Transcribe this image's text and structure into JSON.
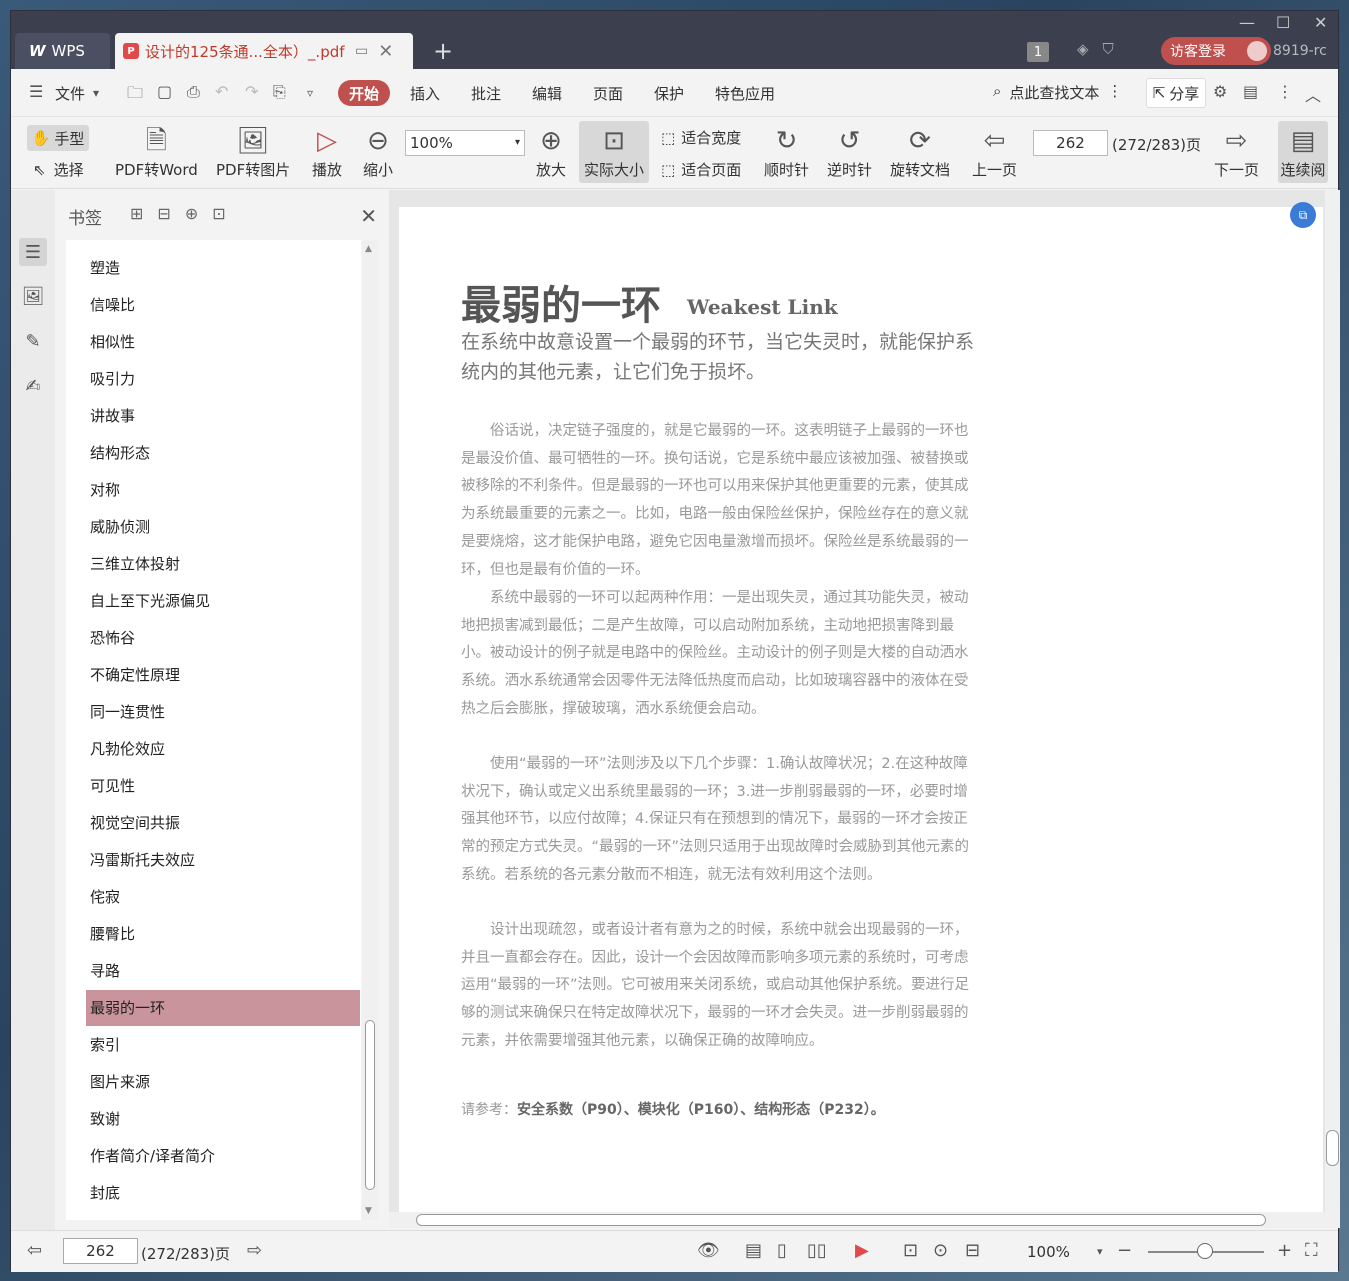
{
  "app": {
    "logo": "WPS",
    "tab_title": "设计的125条通...全本）_.pdf",
    "user": "8919-rc",
    "login": "访客登录",
    "badge": "1"
  },
  "menu": {
    "file": "文件",
    "items": [
      "开始",
      "插入",
      "批注",
      "编辑",
      "页面",
      "保护",
      "特色应用"
    ],
    "search": "点此查找文本",
    "share": "分享"
  },
  "toolbar": {
    "hand": "手型",
    "select": "选择",
    "pdf2word": "PDF转Word",
    "pdf2img": "PDF转图片",
    "play": "播放",
    "zoomout": "缩小",
    "zoom": "100%",
    "zoomin": "放大",
    "actual": "实际大小",
    "fitwidth": "适合宽度",
    "fitpage": "适合页面",
    "cw": "顺时针",
    "ccw": "逆时针",
    "rotate": "旋转文档",
    "prev": "上一页",
    "page": "262",
    "pages": "(272/283)页",
    "next": "下一页",
    "continuous": "连续阅"
  },
  "bookmarks": {
    "title": "书签",
    "items": [
      "塑造",
      "信噪比",
      "相似性",
      "吸引力",
      "讲故事",
      "结构形态",
      "对称",
      "威胁侦测",
      "三维立体投射",
      "自上至下光源偏见",
      "恐怖谷",
      "不确定性原理",
      "同一连贯性",
      "凡勃伦效应",
      "可见性",
      "视觉空间共振",
      "冯雷斯托夫效应",
      "侘寂",
      "腰臀比",
      "寻路",
      "最弱的一环",
      "索引",
      "图片来源",
      "致谢",
      "作者简介/译者简介",
      "封底"
    ],
    "selected": 20
  },
  "doc": {
    "title": "最弱的一环",
    "title_en": "Weakest Link",
    "subtitle": "在系统中故意设置一个最弱的环节，当它失灵时，就能保护系统内的其他元素，让它们免于损坏。",
    "p1": "俗话说，决定链子强度的，就是它最弱的一环。这表明链子上最弱的一环也是最没价值、最可牺牲的一环。换句话说，它是系统中最应该被加强、被替换或被移除的不利条件。但是最弱的一环也可以用来保护其他更重要的元素，使其成为系统最重要的元素之一。比如，电路一般由保险丝保护，保险丝存在的意义就是要烧熔，这才能保护电路，避免它因电量激增而损坏。保险丝是系统最弱的一环，但也是最有价值的一环。",
    "p2": "系统中最弱的一环可以起两种作用：一是出现失灵，通过其功能失灵，被动地把损害减到最低；二是产生故障，可以启动附加系统，主动地把损害降到最小。被动设计的例子就是电路中的保险丝。主动设计的例子则是大楼的自动洒水系统。洒水系统通常会因零件无法降低热度而启动，比如玻璃容器中的液体在受热之后会膨胀，撑破玻璃，洒水系统便会启动。",
    "p3": "使用“最弱的一环”法则涉及以下几个步骤：1.确认故障状况；2.在这种故障状况下，确认或定义出系统里最弱的一环；3.进一步削弱最弱的一环，必要时增强其他环节，以应付故障；4.保证只有在预想到的情况下，最弱的一环才会按正常的预定方式失灵。“最弱的一环”法则只适用于出现故障时会威胁到其他元素的系统。若系统的各元素分散而不相连，就无法有效利用这个法则。",
    "p4": "设计出现疏忽，或者设计者有意为之的时候，系统中就会出现最弱的一环，并且一直都会存在。因此，设计一个会因故障而影响多项元素的系统时，可考虑运用“最弱的一环”法则。它可被用来关闭系统，或启动其他保护系统。要进行足够的测试来确保只在特定故障状况下，最弱的一环才会失灵。进一步削弱最弱的元素，并依需要增强其他元素，以确保正确的故障响应。",
    "refs_label": "请参考：",
    "refs": "安全系数（P90）、模块化（P160）、结构形态（P232）。"
  },
  "status": {
    "page": "262",
    "pages": "(272/283)页",
    "zoom": "100%"
  }
}
